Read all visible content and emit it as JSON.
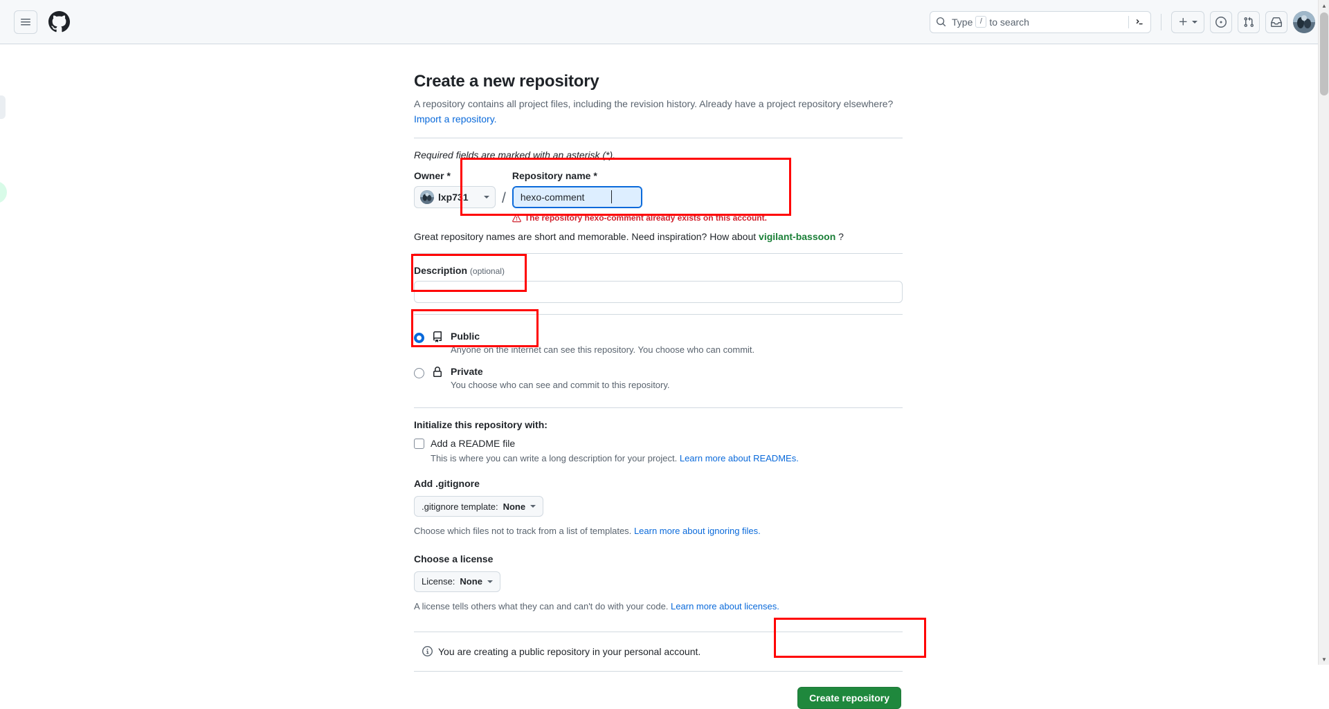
{
  "header": {
    "menu_icon": "hamburger-menu-icon",
    "logo_icon": "github-logo-icon",
    "search": {
      "icon": "search-icon",
      "placeholder_prefix": "Type",
      "placeholder_key": "/",
      "placeholder_suffix": "to search",
      "terminal_icon": "command-palette-icon"
    },
    "create_new_label": "+",
    "issues_icon": "issues-circle-dot-icon",
    "pull_requests_icon": "pull-request-icon",
    "inbox_icon": "inbox-icon",
    "avatar_icon": "user-avatar"
  },
  "page": {
    "title": "Create a new repository",
    "lede_text": "A repository contains all project files, including the revision history. Already have a project repository elsewhere?",
    "import_link": "Import a repository.",
    "required_note": "Required fields are marked with an asterisk (*)."
  },
  "owner_field": {
    "label": "Owner *",
    "selected_owner": "lxp731",
    "separator": "/"
  },
  "repo_name_field": {
    "label": "Repository name *",
    "value": "hexo-comment",
    "error_icon": "alert-icon",
    "error_message": "The repository hexo-comment already exists on this account."
  },
  "name_hint": {
    "prefix": "Great repository names are short and memorable. Need inspiration? How about",
    "suggestion": "vigilant-bassoon",
    "suffix": "?"
  },
  "description_field": {
    "label": "Description",
    "optional_tag": "(optional)",
    "value": "",
    "placeholder": ""
  },
  "visibility": {
    "options": [
      {
        "id": "public",
        "title": "Public",
        "description": "Anyone on the internet can see this repository. You choose who can commit.",
        "icon": "repo-book-icon",
        "checked": true
      },
      {
        "id": "private",
        "title": "Private",
        "description": "You choose who can see and commit to this repository.",
        "icon": "lock-icon",
        "checked": false
      }
    ]
  },
  "initialize": {
    "heading": "Initialize this repository with:",
    "readme": {
      "label": "Add a README file",
      "checked": false,
      "description_prefix": "This is where you can write a long description for your project.",
      "description_link": "Learn more about READMEs."
    }
  },
  "gitignore": {
    "heading": "Add .gitignore",
    "button_label_prefix": ".gitignore template:",
    "button_value": "None",
    "helper_prefix": "Choose which files not to track from a list of templates.",
    "helper_link": "Learn more about ignoring files."
  },
  "license": {
    "heading": "Choose a license",
    "button_label_prefix": "License:",
    "button_value": "None",
    "helper_prefix": "A license tells others what they can and can't do with your code.",
    "helper_link": "Learn more about licenses."
  },
  "footer": {
    "notice_icon": "info-icon",
    "notice_text": "You are creating a public repository in your personal account.",
    "submit_label": "Create repository"
  },
  "colors": {
    "accent_blue": "#0969da",
    "danger_red": "#cf222e",
    "success_green": "#1f883d",
    "suggestion_green": "#1a7f37",
    "highlight_outline": "#ff0000",
    "border": "#d1d9e0",
    "muted_text": "#59636e",
    "text": "#1f2328"
  }
}
